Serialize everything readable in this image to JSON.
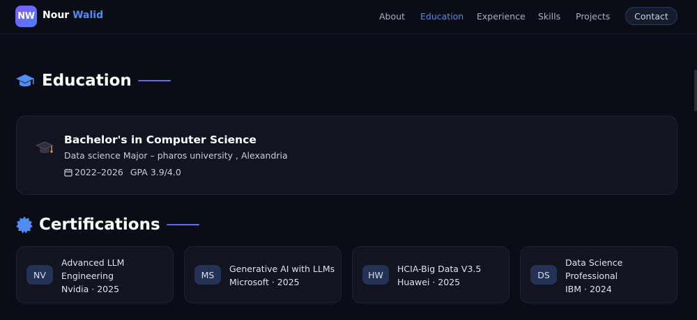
{
  "brand": {
    "logo_text": "NW",
    "first_name": "Nour",
    "last_name": "Walid"
  },
  "nav": {
    "items": [
      {
        "label": "About",
        "active": false
      },
      {
        "label": "Education",
        "active": true
      },
      {
        "label": "Experience",
        "active": false
      },
      {
        "label": "Skills",
        "active": false
      },
      {
        "label": "Projects",
        "active": false
      }
    ],
    "contact_label": "Contact"
  },
  "education": {
    "heading": "Education",
    "icon": "graduation-cap-icon",
    "entry": {
      "degree": "Bachelor's in Computer Science",
      "school": "Data science Major – pharos university , Alexandria",
      "years": "2022–2026",
      "gpa": "GPA 3.9/4.0"
    }
  },
  "certifications": {
    "heading": "Certifications",
    "icon": "badge-icon",
    "items": [
      {
        "abbr": "NV",
        "title_lines": [
          "Advanced LLM",
          "Engineering"
        ],
        "issuer": "Nvidia · 2025"
      },
      {
        "abbr": "MS",
        "title_lines": [
          "Generative AI with LLMs"
        ],
        "issuer": "Microsoft · 2025"
      },
      {
        "abbr": "HW",
        "title_lines": [
          "HCIA-Big Data V3.5"
        ],
        "issuer": "Huawei · 2025"
      },
      {
        "abbr": "DS",
        "title_lines": [
          "Data Science",
          "Professional"
        ],
        "issuer": "IBM · 2024"
      }
    ]
  },
  "colors": {
    "background": "#0b0d16",
    "accent": "#4f8df5",
    "card": "#121520"
  }
}
